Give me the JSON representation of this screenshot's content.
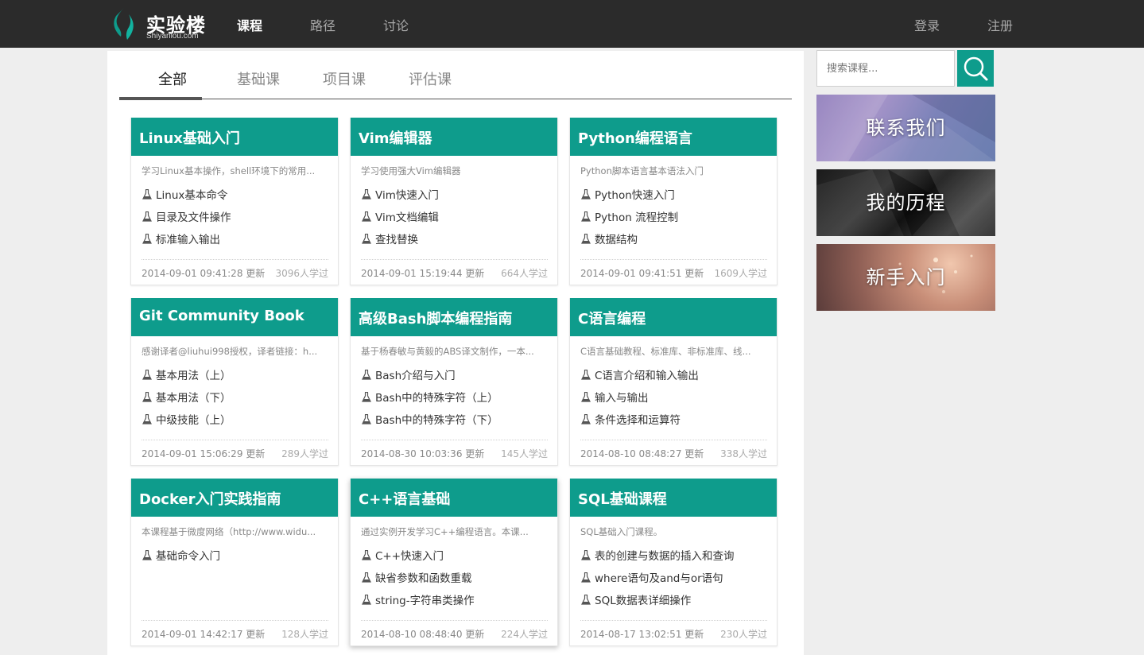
{
  "brand": {
    "name": "实验楼",
    "sub": "Shiyanlou.com",
    "mark_color": "#0e9c8c"
  },
  "nav": {
    "items": [
      {
        "label": "课程",
        "active": true
      },
      {
        "label": "路径",
        "active": false
      },
      {
        "label": "讨论",
        "active": false
      }
    ],
    "login": "登录",
    "register": "注册"
  },
  "tabs": [
    {
      "label": "全部",
      "active": true
    },
    {
      "label": "基础课",
      "active": false
    },
    {
      "label": "项目课",
      "active": false
    },
    {
      "label": "评估课",
      "active": false
    }
  ],
  "courses": [
    {
      "title": "Linux基础入门",
      "desc": "学习Linux基本操作，shell环境下的常用...",
      "labs": [
        "Linux基本命令",
        "目录及文件操作",
        "标准输入输出"
      ],
      "updated": "2014-09-01 09:41:28 更新",
      "learners": "3096人学过"
    },
    {
      "title": "Vim编辑器",
      "desc": "学习使用强大Vim编辑器",
      "labs": [
        "Vim快速入门",
        "Vim文档编辑",
        "查找替换"
      ],
      "updated": "2014-09-01 15:19:44 更新",
      "learners": "664人学过"
    },
    {
      "title": "Python编程语言",
      "desc": "Python脚本语言基本语法入门",
      "labs": [
        "Python快速入门",
        "Python 流程控制",
        "数据结构"
      ],
      "updated": "2014-09-01 09:41:51 更新",
      "learners": "1609人学过"
    },
    {
      "title": "Git Community Book",
      "desc": "感谢译者@liuhui998授权，译者链接：h...",
      "labs": [
        "基本用法（上）",
        "基本用法（下）",
        "中级技能（上）"
      ],
      "updated": "2014-09-01 15:06:29 更新",
      "learners": "289人学过"
    },
    {
      "title": "高级Bash脚本编程指南",
      "desc": "基于杨春敏与黄毅的ABS译文制作，一本...",
      "labs": [
        "Bash介绍与入门",
        "Bash中的特殊字符（上）",
        "Bash中的特殊字符（下）"
      ],
      "updated": "2014-08-30 10:03:36 更新",
      "learners": "145人学过"
    },
    {
      "title": "C语言编程",
      "desc": "C语言基础教程、标准库、非标准库、线...",
      "labs": [
        "C语言介绍和输入输出",
        "输入与输出",
        "条件选择和运算符"
      ],
      "updated": "2014-08-10 08:48:27 更新",
      "learners": "338人学过"
    },
    {
      "title": "Docker入门实践指南",
      "desc": "本课程基于微度网络（http://www.widu...",
      "labs": [
        "基础命令入门"
      ],
      "updated": "2014-09-01 14:42:17 更新",
      "learners": "128人学过"
    },
    {
      "title": "C++语言基础",
      "desc": "通过实例开发学习C++编程语言。本课...",
      "labs": [
        "C++快速入门",
        "缺省参数和函数重载",
        "string-字符串类操作"
      ],
      "updated": "2014-08-10 08:48:40 更新",
      "learners": "224人学过"
    },
    {
      "title": "SQL基础课程",
      "desc": "SQL基础入门课程。",
      "labs": [
        "表的创建与数据的插入和查询",
        "where语句及and与or语句",
        "SQL数据表详细操作"
      ],
      "updated": "2014-08-17 13:02:51 更新",
      "learners": "230人学过"
    }
  ],
  "sidebar": {
    "search_placeholder": "搜索课程...",
    "banners": [
      {
        "label": "联系我们"
      },
      {
        "label": "我的历程"
      },
      {
        "label": "新手入门"
      }
    ]
  },
  "colors": {
    "accent": "#0e9c8c",
    "navbar": "#2b2b2b",
    "background": "#eeeeee"
  },
  "icons": {
    "lab": "flask-icon",
    "search": "search-icon"
  }
}
